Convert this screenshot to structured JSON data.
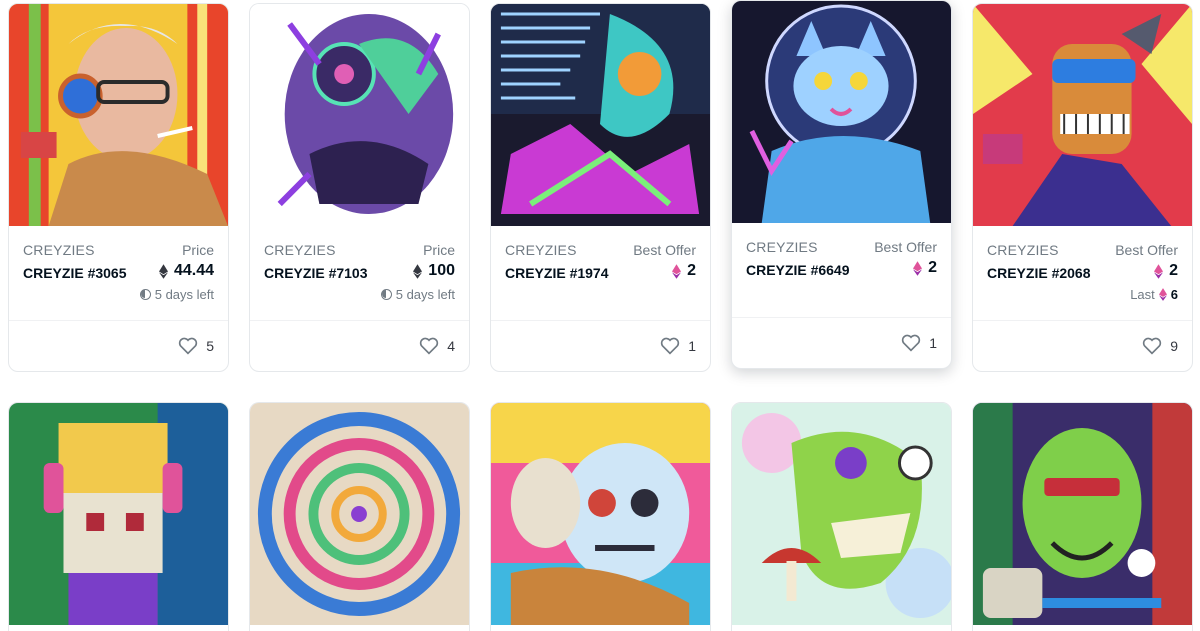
{
  "cards": [
    {
      "collection": "CREYZIES",
      "title": "CREYZIE #3065",
      "price_label": "Price",
      "price": "44.44",
      "eth": "black",
      "sub": "5 days left",
      "sub_type": "time",
      "likes": "5"
    },
    {
      "collection": "CREYZIES",
      "title": "CREYZIE #7103",
      "price_label": "Price",
      "price": "100",
      "eth": "black",
      "sub": "5 days left",
      "sub_type": "time",
      "likes": "4"
    },
    {
      "collection": "CREYZIES",
      "title": "CREYZIE #1974",
      "price_label": "Best Offer",
      "price": "2",
      "eth": "pink",
      "sub": "",
      "sub_type": "none",
      "likes": "1"
    },
    {
      "collection": "CREYZIES",
      "title": "CREYZIE #6649",
      "price_label": "Best Offer",
      "price": "2",
      "eth": "pink",
      "sub": "",
      "sub_type": "none",
      "likes": "1"
    },
    {
      "collection": "CREYZIES",
      "title": "CREYZIE #2068",
      "price_label": "Best Offer",
      "price": "2",
      "eth": "pink",
      "sub_label": "Last",
      "sub": "6",
      "sub_type": "last",
      "likes": "9"
    }
  ],
  "icons": {
    "heart": "heart-icon",
    "eth": "ethereum-icon",
    "clock": "clock-icon"
  },
  "colors": {
    "eth_black": "#353840",
    "eth_pink": "#e0539a",
    "text_muted": "#707a83",
    "text_dark": "#04111d"
  }
}
